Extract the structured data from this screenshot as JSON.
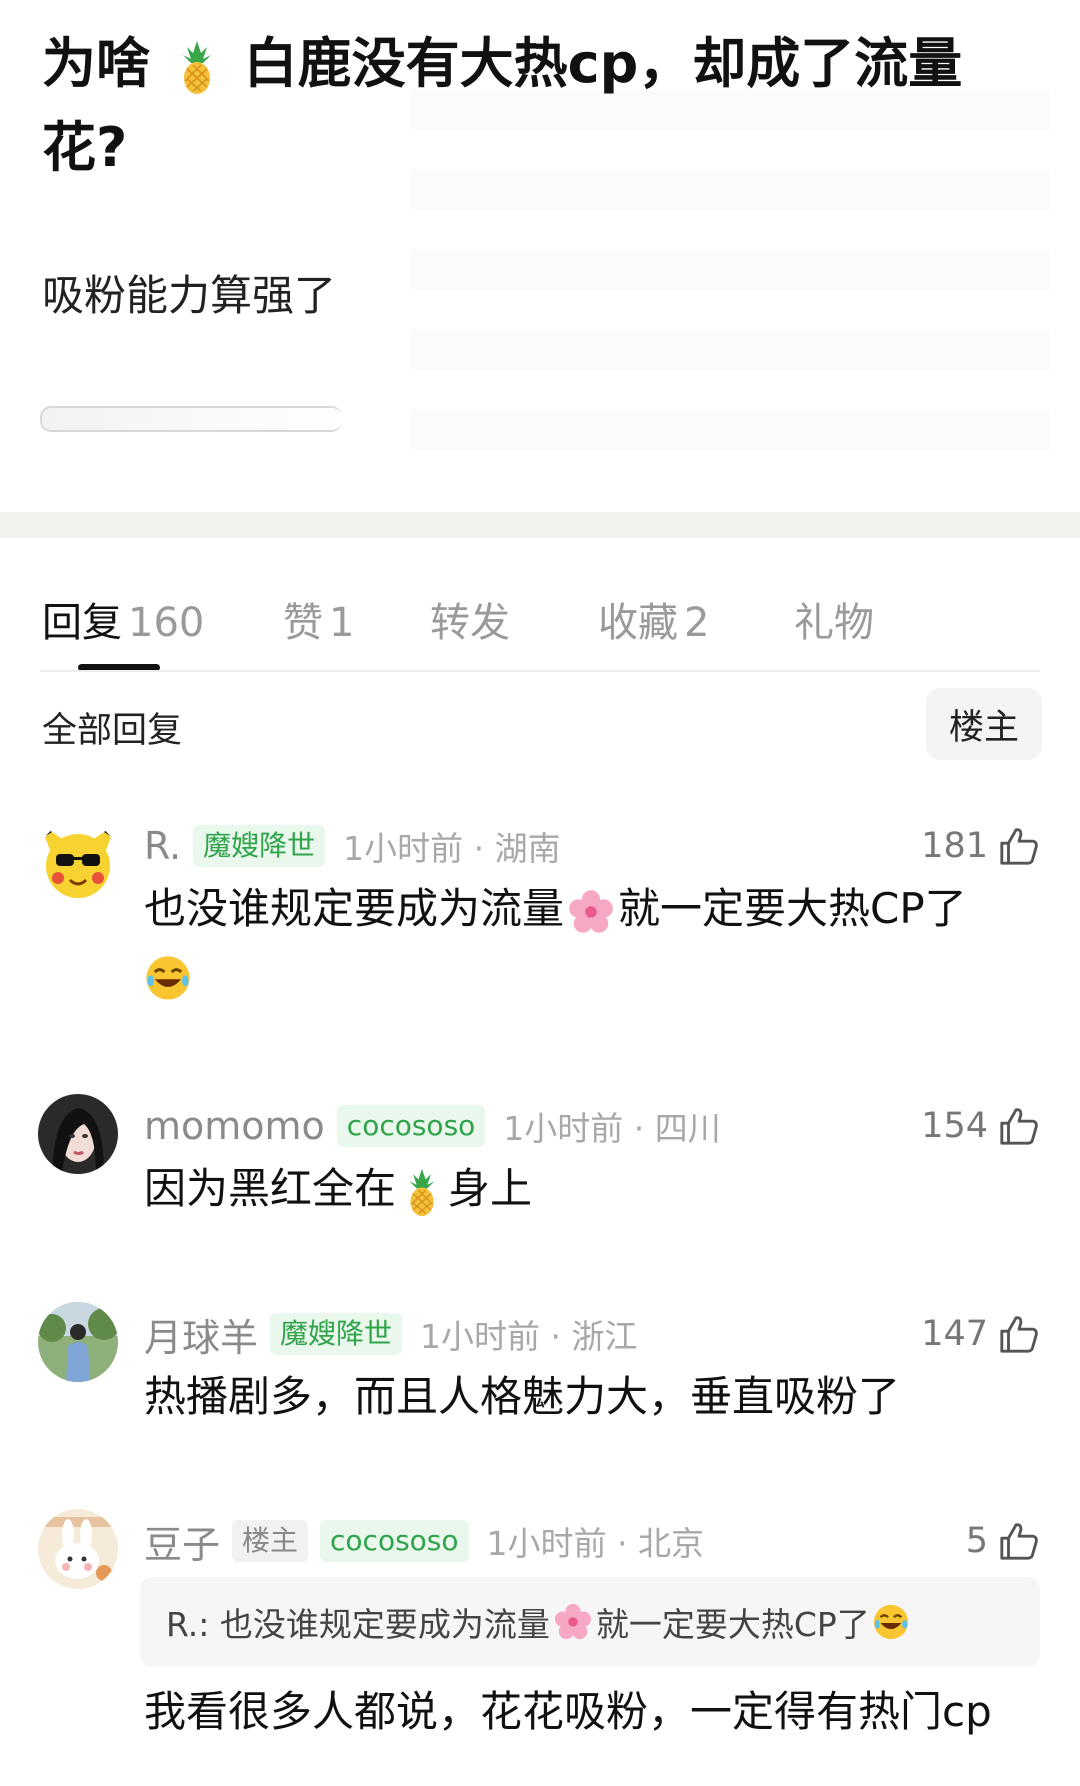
{
  "post": {
    "title_a": "为啥",
    "title_b": "白鹿没有大热cp，却成了流量",
    "title_c": "花?",
    "body": "吸粉能力算强了"
  },
  "tabs": [
    {
      "label": "回复",
      "count": "160"
    },
    {
      "label": "赞",
      "count": "1"
    },
    {
      "label": "转发",
      "count": ""
    },
    {
      "label": "收藏",
      "count": "2"
    },
    {
      "label": "礼物",
      "count": ""
    }
  ],
  "filter": {
    "all_label": "全部回复",
    "host_label": "楼主"
  },
  "comments": [
    {
      "name": "R.",
      "badge": "魔嫂降世",
      "time": "1小时前 · 湖南",
      "likes": "181",
      "text_a": "也没谁规定要成为流量",
      "text_b": "就一定要大热CP了"
    },
    {
      "name": "momomo",
      "badge": "cocososo",
      "time": "1小时前 · 四川",
      "likes": "154",
      "text_a": "因为黑红全在",
      "text_b": "身上"
    },
    {
      "name": "月球羊",
      "badge": "魔嫂降世",
      "time": "1小时前 · 浙江",
      "likes": "147",
      "text_a": "热播剧多，而且人格魅力大，垂直吸粉了"
    },
    {
      "name": "豆子",
      "host_badge": "楼主",
      "badge": "cocososo",
      "time": "1小时前 · 北京",
      "likes": "5",
      "quote_a": "R.: 也没谁规定要成为流量",
      "quote_b": "就一定要大热CP了",
      "text_a": "我看很多人都说，花花吸粉，一定得有热门cp"
    }
  ],
  "icons": {
    "like": "thumbs-up-icon",
    "pineapple": "pineapple-emoji",
    "flower": "cherry-blossom-emoji",
    "laugh": "tears-of-joy-emoji"
  }
}
